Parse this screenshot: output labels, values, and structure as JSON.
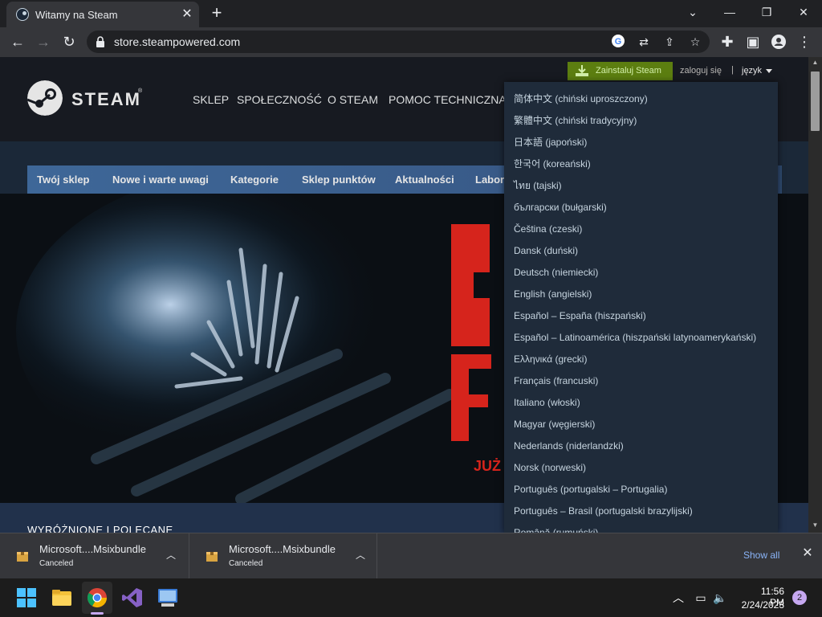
{
  "browser": {
    "tab_title": "Witamy na Steam",
    "url": "store.steampowered.com",
    "window_controls": [
      "minimize",
      "restore",
      "close"
    ]
  },
  "steam_header": {
    "install_button": "Zainstaluj Steam",
    "login": "zaloguj się",
    "separator": "|",
    "language": "język",
    "logo_text": "STEAM",
    "logo_tm": "®",
    "nav": [
      "SKLEP",
      "SPOŁECZNOŚĆ",
      "O STEAM",
      "POMOC TECHNICZNA"
    ]
  },
  "store_nav": [
    "Twój sklep",
    "Nowe i warte uwagi",
    "Kategorie",
    "Sklep punktów",
    "Aktualności",
    "Labor"
  ],
  "hero": {
    "title_fragment_1": "S",
    "title_fragment_2": "F",
    "subtitle_fragment": "JUŻ"
  },
  "featured_title": "WYRÓŻNIONE I POLECANE",
  "language_menu": [
    "简体中文 (chiński uproszczony)",
    "繁體中文 (chiński tradycyjny)",
    "日本語 (japoński)",
    "한국어 (koreański)",
    "ไทย (tajski)",
    "български (bułgarski)",
    "Čeština (czeski)",
    "Dansk (duński)",
    "Deutsch (niemiecki)",
    "English (angielski)",
    "Español – España (hiszpański)",
    "Español – Latinoamérica (hiszpański latynoamerykański)",
    "Ελληνικά (grecki)",
    "Français (francuski)",
    "Italiano (włoski)",
    "Magyar (węgierski)",
    "Nederlands (niderlandzki)",
    "Norsk (norweski)",
    "Português (portugalski – Portugalia)",
    "Português – Brasil (portugalski brazylijski)",
    "Română (rumuński)"
  ],
  "downloads": {
    "items": [
      {
        "name": "Microsoft....Msixbundle",
        "status": "Canceled"
      },
      {
        "name": "Microsoft....Msixbundle",
        "status": "Canceled"
      }
    ],
    "show_all": "Show all"
  },
  "taskbar": {
    "apps": [
      "windows-start",
      "file-explorer",
      "chrome",
      "visual-studio",
      "control-panel"
    ],
    "time": "11:56 PM",
    "date": "2/24/2023",
    "notifications": "2"
  },
  "colors": {
    "steam_header_bg": "#171a21",
    "steam_body_bg": "#1b2838",
    "install_green": "#5c7e10",
    "store_nav_blue": "#3e6798",
    "hero_red": "#d6241c",
    "chrome_dark": "#202124",
    "chrome_toolbar": "#35363a",
    "link_blue": "#8ab4f8"
  }
}
